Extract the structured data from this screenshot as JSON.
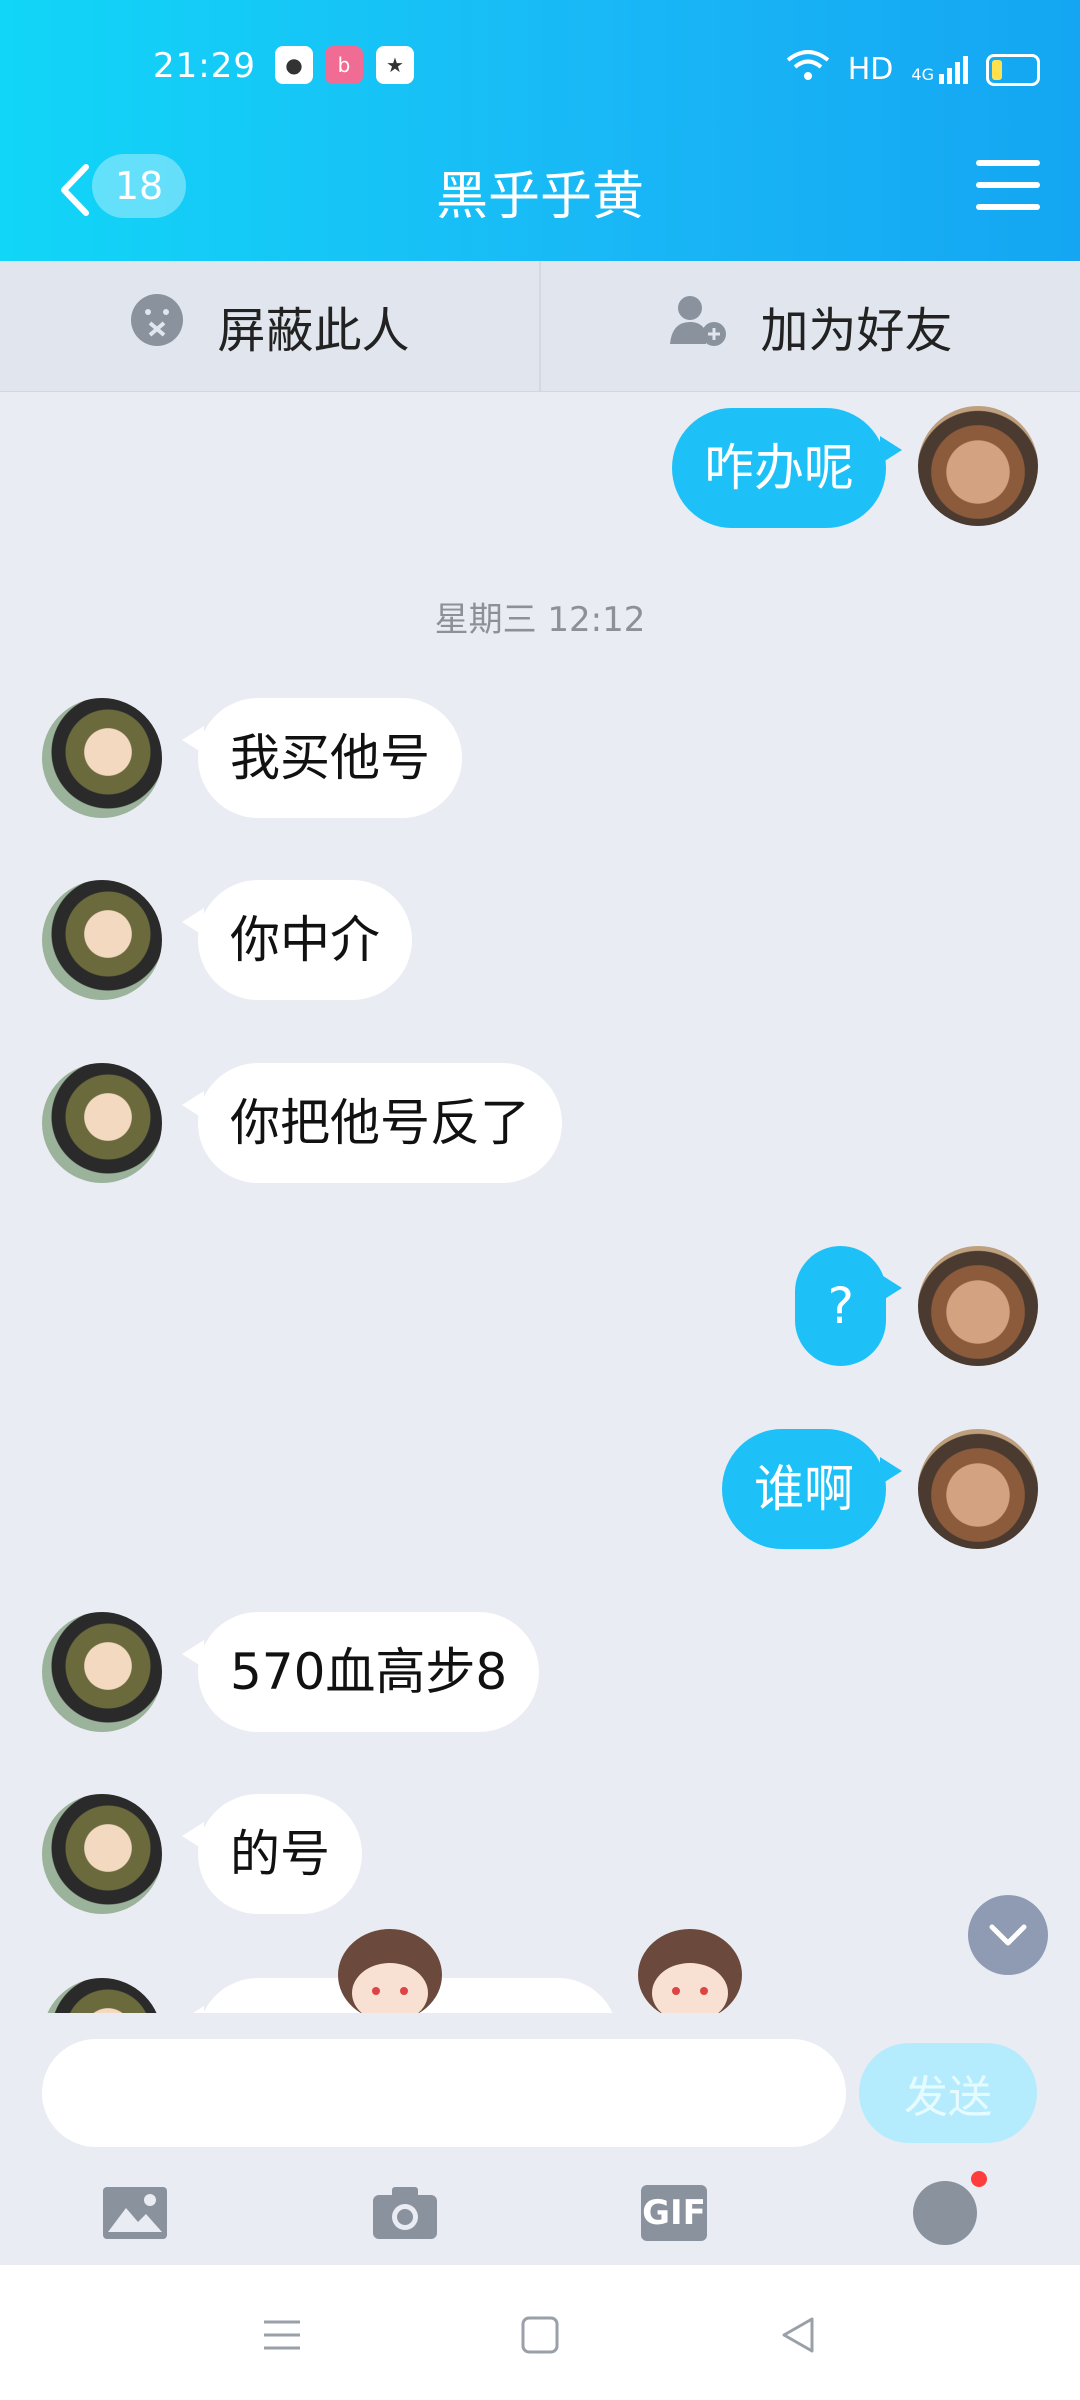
{
  "status_bar": {
    "time": "21:29",
    "network": "HD",
    "signal_label": "4G"
  },
  "header": {
    "unread_count": "18",
    "title": "黑乎乎黄"
  },
  "actions": {
    "block_label": "屏蔽此人",
    "add_friend_label": "加为好友"
  },
  "chat": {
    "timestamp": "星期三 12:12",
    "messages": [
      {
        "side": "right",
        "text": "咋办呢"
      },
      {
        "side": "left",
        "text": "我买他号"
      },
      {
        "side": "left",
        "text": "你中介"
      },
      {
        "side": "left",
        "text": "你把他号反了"
      },
      {
        "side": "right",
        "text": "?"
      },
      {
        "side": "right",
        "text": "谁啊"
      },
      {
        "side": "left",
        "text": "570血高步8"
      },
      {
        "side": "left",
        "text": "的号"
      }
    ]
  },
  "composer": {
    "placeholder": "",
    "send_label": "发送"
  },
  "toolbar": {
    "gif_label": "GIF"
  },
  "colors": {
    "header_start": "#11d6f7",
    "header_end": "#14a6f2",
    "bubble_right": "#1ec1f7",
    "bubble_left": "#ffffff",
    "background": "#e9ecf3"
  }
}
